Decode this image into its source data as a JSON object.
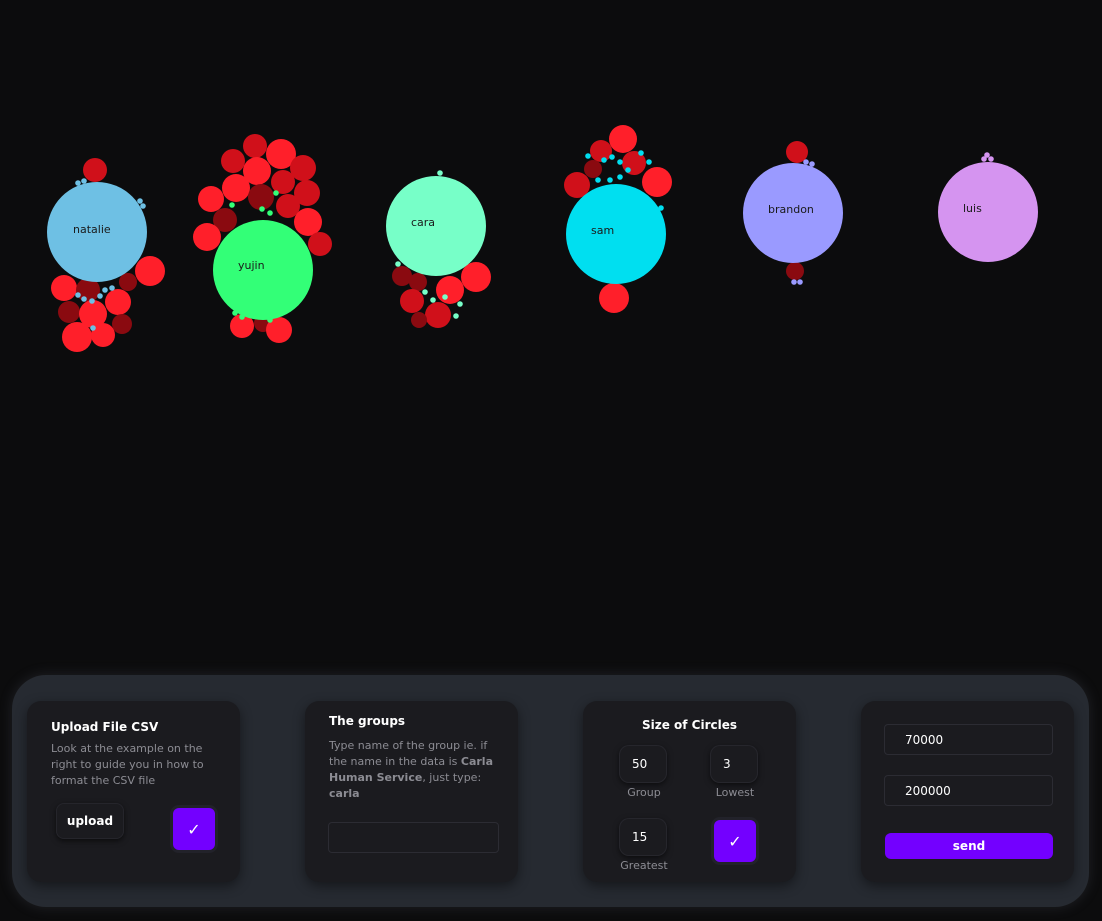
{
  "visualization": {
    "groups": [
      {
        "name": "natalie",
        "color": "#6ec0e4"
      },
      {
        "name": "yujin",
        "color": "#33ff77"
      },
      {
        "name": "cara",
        "color": "#77ffc8"
      },
      {
        "name": "sam",
        "color": "#00dff0"
      },
      {
        "name": "brandon",
        "color": "#9a9aff"
      },
      {
        "name": "luis",
        "color": "#d594f0"
      }
    ],
    "item_colors": {
      "bright": "#ff1f2a",
      "dark": "#8a0a10",
      "medium": "#d0101a"
    }
  },
  "upload_card": {
    "title": "Upload File CSV",
    "description": "Look at the example on the right to guide you in how to format the CSV file",
    "upload_label": "upload",
    "confirm_label": "✓"
  },
  "groups_card": {
    "title": "The groups",
    "desc_pre": "Type name of the group ie. if the name in the data is ",
    "desc_bold1": "Carla Human Service",
    "desc_mid": ", just type: ",
    "desc_bold2": "carla",
    "input_value": ""
  },
  "size_card": {
    "title": "Size of Circles",
    "group_value": "50",
    "group_label": "Group",
    "lowest_value": "3",
    "lowest_label": "Lowest",
    "greatest_value": "15",
    "greatest_label": "Greatest",
    "confirm_label": "✓"
  },
  "range_card": {
    "min_value": "70000",
    "max_value": "200000",
    "send_label": "send"
  },
  "colors": {
    "accent": "#7300ff",
    "background": "#0c0c0d",
    "panel": "#262a31",
    "card": "#1b1b1f"
  }
}
